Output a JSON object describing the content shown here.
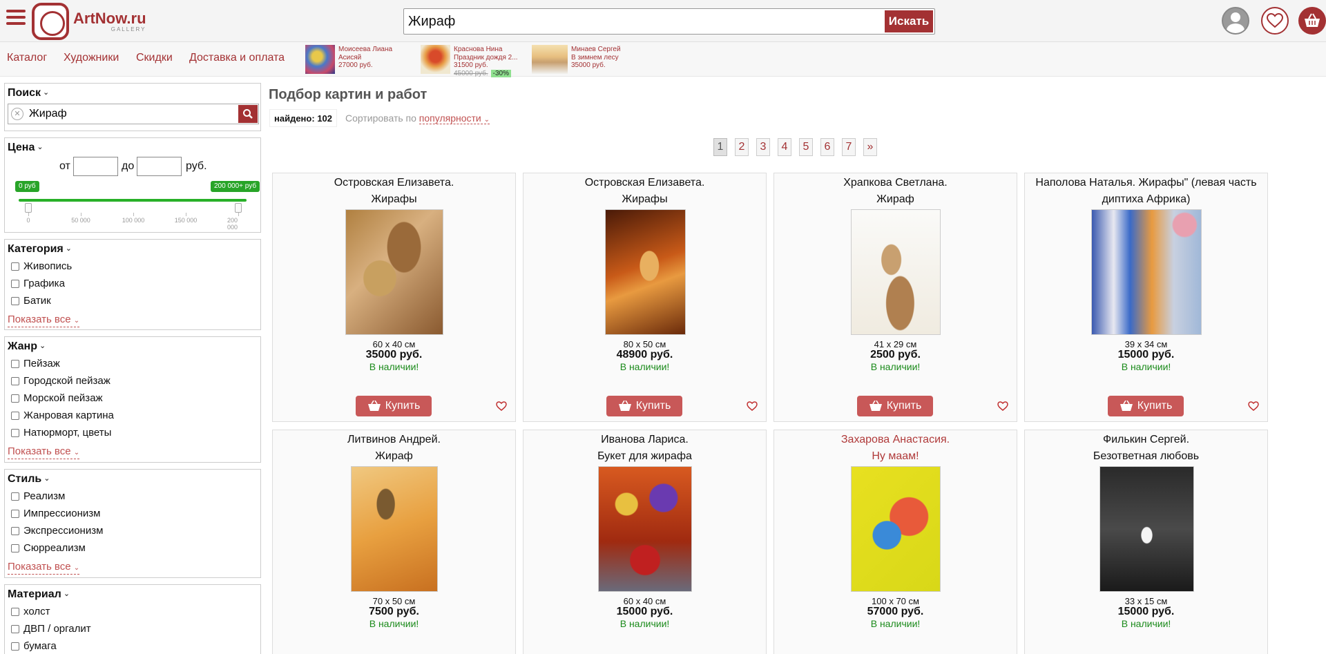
{
  "header": {
    "logo_name": "ArtNow.ru",
    "logo_sub": "GALLERY",
    "search_value": "Жираф",
    "search_button": "Искать"
  },
  "nav": {
    "links": [
      "Каталог",
      "Художники",
      "Скидки",
      "Доставка и оплата"
    ],
    "promos": [
      {
        "artist": "Моисеева Лиана",
        "title": "Асисяй",
        "price": "27000 руб.",
        "old_price": "",
        "badge": ""
      },
      {
        "artist": "Краснова Нина",
        "title": "Праздник дождя 2...",
        "price": "31500 руб.",
        "old_price": "45000 руб.",
        "badge": "-30%"
      },
      {
        "artist": "Минаев Сергей",
        "title": "В зимнем лесу",
        "price": "35000 руб.",
        "old_price": "",
        "badge": ""
      }
    ]
  },
  "sidebar": {
    "search": {
      "title": "Поиск",
      "value": "Жираф"
    },
    "price": {
      "title": "Цена",
      "from_label": "от",
      "to_label": "до",
      "currency": "руб.",
      "min_badge": "0 руб",
      "max_badge": "200 000+ руб",
      "scale": [
        "0",
        "50 000",
        "100 000",
        "150 000",
        "200 000"
      ]
    },
    "category": {
      "title": "Категория",
      "items": [
        "Живопись",
        "Графика",
        "Батик"
      ],
      "show_all": "Показать все"
    },
    "genre": {
      "title": "Жанр",
      "items": [
        "Пейзаж",
        "Городской пейзаж",
        "Морской пейзаж",
        "Жанровая картина",
        "Натюрморт, цветы"
      ],
      "show_all": "Показать все"
    },
    "style": {
      "title": "Стиль",
      "items": [
        "Реализм",
        "Импрессионизм",
        "Экспрессионизм",
        "Сюрреализм"
      ],
      "show_all": "Показать все"
    },
    "material": {
      "title": "Материал",
      "items": [
        "холст",
        "ДВП / оргалит",
        "бумага"
      ]
    }
  },
  "main": {
    "title": "Подбор картин и работ",
    "found_label": "найдено:",
    "found_count": "102",
    "sort_label": "Сортировать по",
    "sort_value": "популярности",
    "pages": [
      "1",
      "2",
      "3",
      "4",
      "5",
      "6",
      "7",
      "»"
    ],
    "buy_label": "Купить",
    "products": [
      {
        "author": "Островская Елизавета.",
        "title": "Жирафы",
        "size": "60 x 40 см",
        "price": "35000 руб.",
        "stock": "В наличии!"
      },
      {
        "author": "Островская Елизавета.",
        "title": "Жирафы",
        "size": "80 x 50 см",
        "price": "48900 руб.",
        "stock": "В наличии!"
      },
      {
        "author": "Храпкова Светлана.",
        "title": "Жираф",
        "size": "41 x 29 см",
        "price": "2500 руб.",
        "stock": "В наличии!"
      },
      {
        "author": "Наполова Наталья. Жирафы\" (левая часть",
        "title": "диптиха Африка)",
        "size": "39 x 34 см",
        "price": "15000 руб.",
        "stock": "В наличии!"
      },
      {
        "author": "Литвинов Андрей.",
        "title": "Жираф",
        "size": "70 x 50 см",
        "price": "7500 руб.",
        "stock": "В наличии!"
      },
      {
        "author": "Иванова Лариса.",
        "title": "Букет для жирафа",
        "size": "60 x 40 см",
        "price": "15000 руб.",
        "stock": "В наличии!"
      },
      {
        "author": "Захарова Анастасия.",
        "title": "Ну маам!",
        "size": "100 x 70 см",
        "price": "57000 руб.",
        "stock": "В наличии!"
      },
      {
        "author": "Филькин Сергей.",
        "title": "Безответная любовь",
        "size": "33 x 15 см",
        "price": "15000 руб.",
        "stock": "В наличии!"
      }
    ]
  },
  "colors": {
    "brand": "#a33133",
    "buy_button": "#c85858",
    "in_stock": "#1a8a1a",
    "slider": "#28b028"
  }
}
